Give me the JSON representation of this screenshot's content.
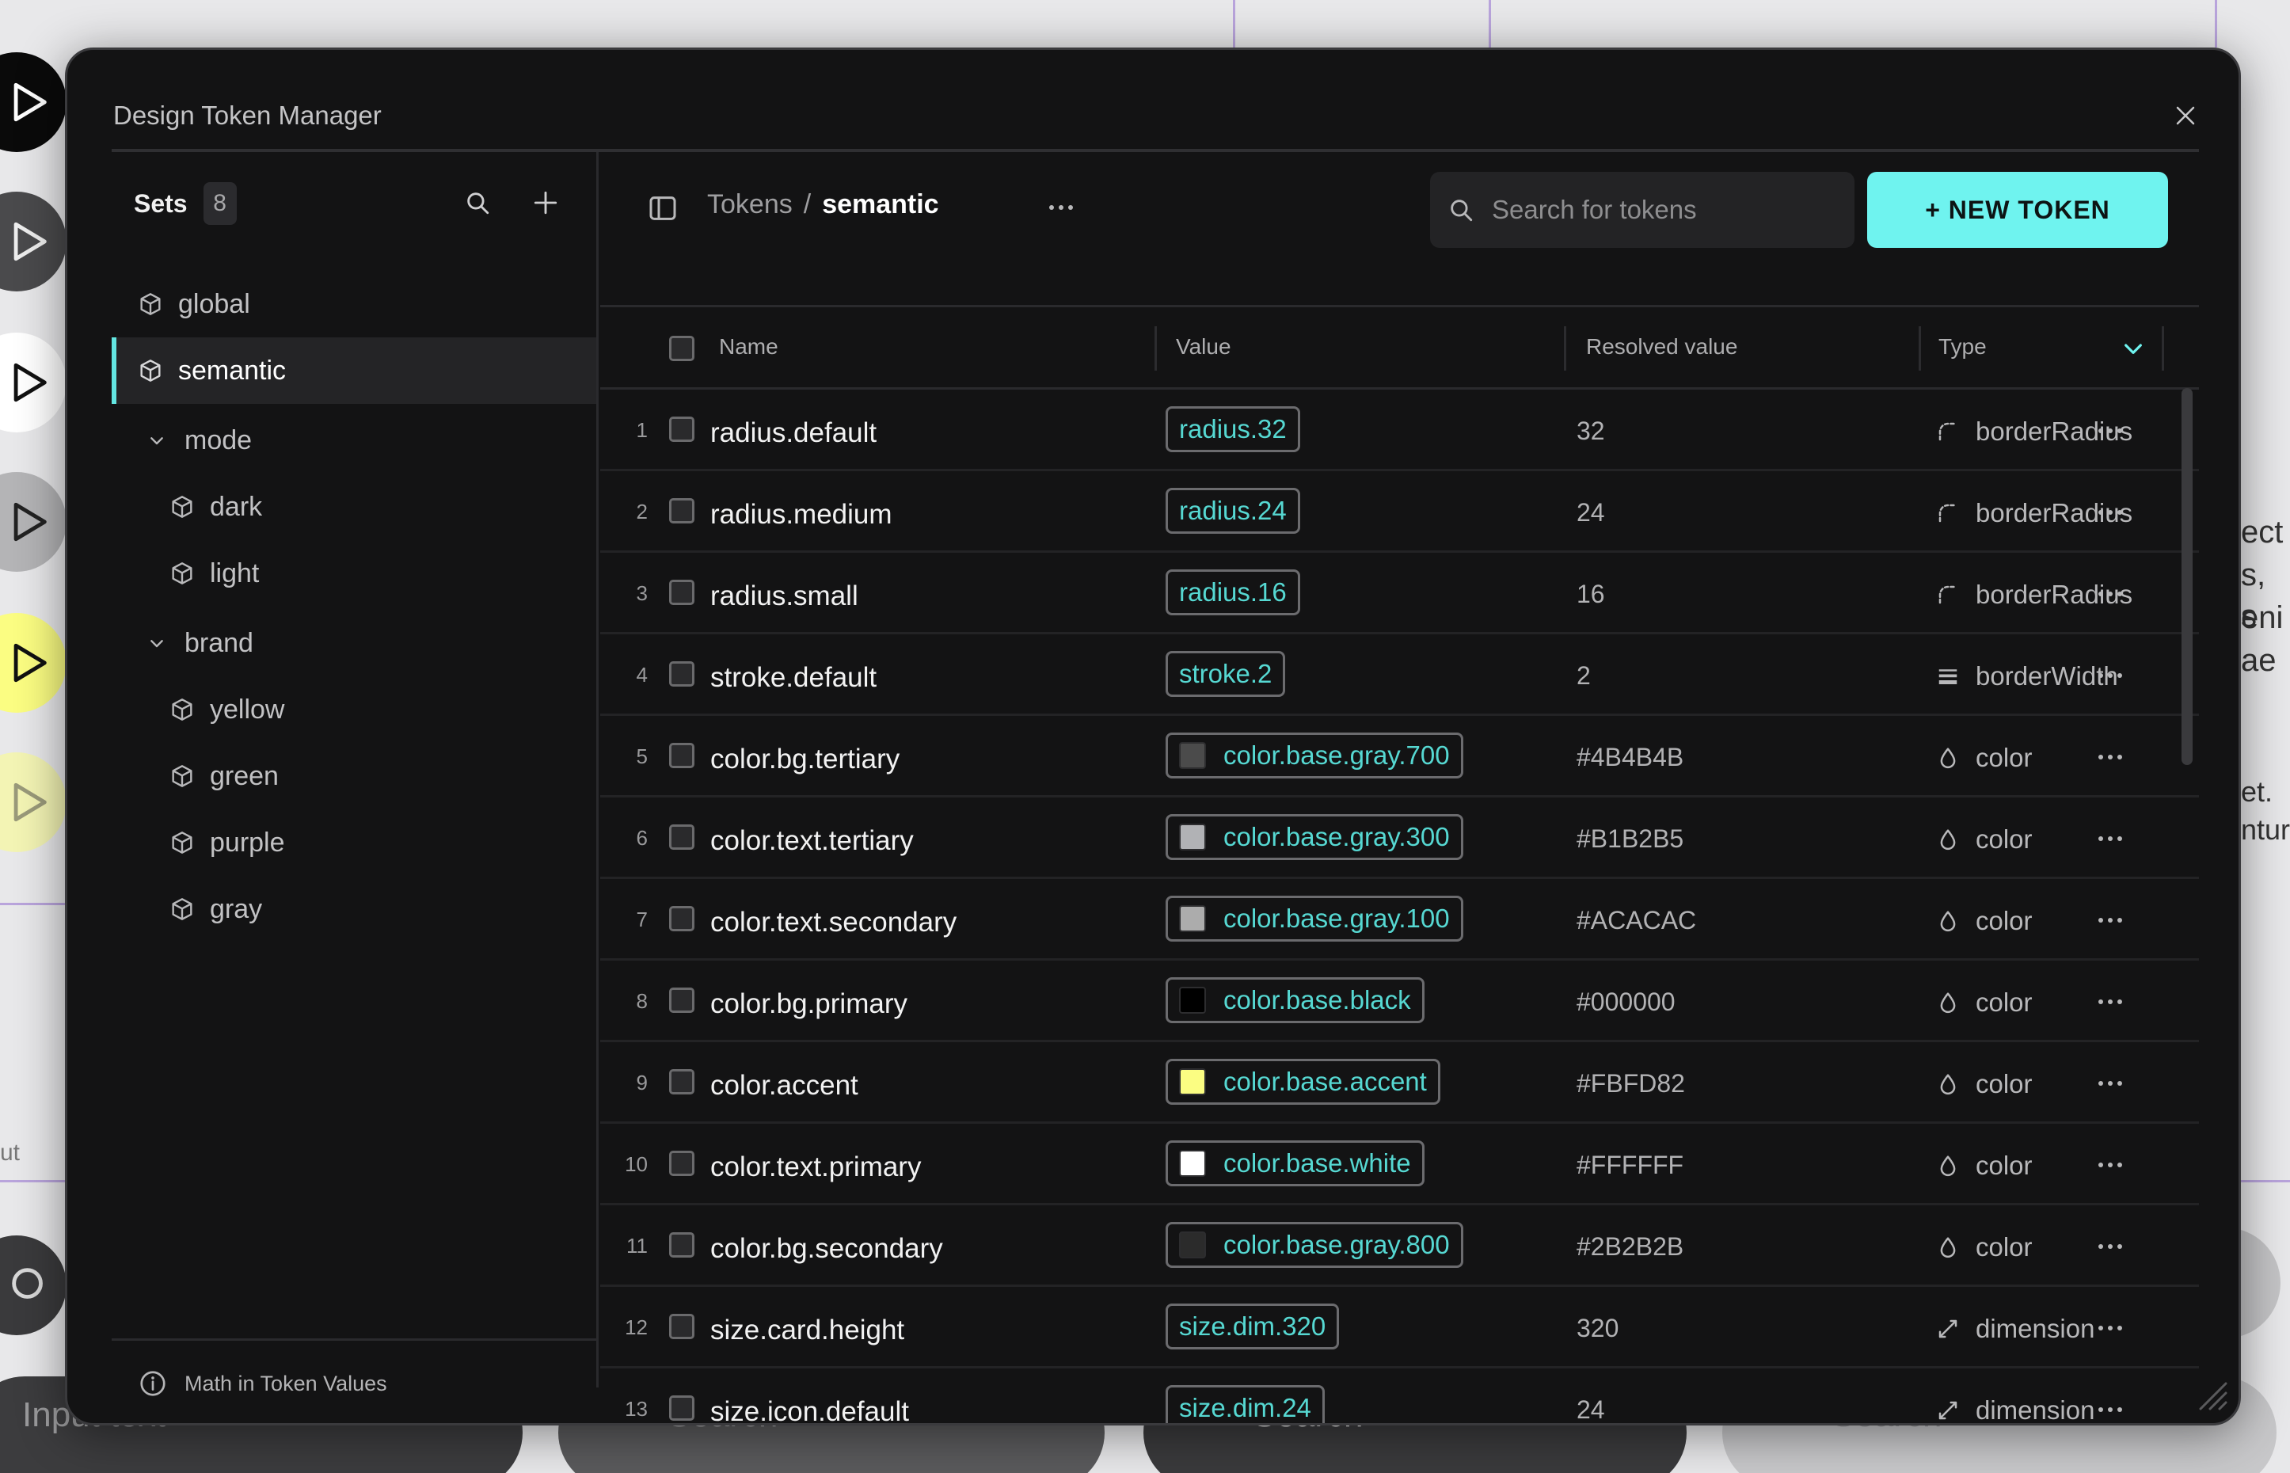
{
  "background": {
    "fragments": [
      "ect",
      "s, s",
      "eni",
      "ae",
      "et.",
      "ntur",
      "ut"
    ],
    "inputs": [
      "Input text",
      "Search",
      "Search",
      "Search"
    ]
  },
  "dialog": {
    "title": "Design Token Manager"
  },
  "sidebar": {
    "sets_label": "Sets",
    "sets_count": "8",
    "items": [
      {
        "label": "global",
        "icon": "cube-icon",
        "active": false
      },
      {
        "label": "semantic",
        "icon": "cube-icon",
        "active": true
      },
      {
        "label": "mode",
        "icon": "chevron-down-icon",
        "active": false
      },
      {
        "label": "dark",
        "icon": "cube-icon",
        "active": false
      },
      {
        "label": "light",
        "icon": "cube-icon",
        "active": false
      },
      {
        "label": "brand",
        "icon": "chevron-down-icon",
        "active": false
      },
      {
        "label": "yellow",
        "icon": "cube-icon",
        "active": false
      },
      {
        "label": "green",
        "icon": "cube-icon",
        "active": false
      },
      {
        "label": "purple",
        "icon": "cube-icon",
        "active": false
      },
      {
        "label": "gray",
        "icon": "cube-icon",
        "active": false
      }
    ],
    "footer_link": "Math in Token Values"
  },
  "toolbar": {
    "breadcrumb_root": "Tokens",
    "breadcrumb_sep": "/",
    "breadcrumb_current": "semantic",
    "search_placeholder": "Search for tokens",
    "new_token_label": "+ NEW TOKEN"
  },
  "table": {
    "headers": {
      "name": "Name",
      "value": "Value",
      "resolved": "Resolved value",
      "type": "Type"
    },
    "rows": [
      {
        "num": "1",
        "name": "radius.default",
        "value": "radius.32",
        "resolved": "32",
        "type": "borderRadius",
        "type_icon": "border-radius-icon",
        "swatch": null
      },
      {
        "num": "2",
        "name": "radius.medium",
        "value": "radius.24",
        "resolved": "24",
        "type": "borderRadius",
        "type_icon": "border-radius-icon",
        "swatch": null
      },
      {
        "num": "3",
        "name": "radius.small",
        "value": "radius.16",
        "resolved": "16",
        "type": "borderRadius",
        "type_icon": "border-radius-icon",
        "swatch": null
      },
      {
        "num": "4",
        "name": "stroke.default",
        "value": "stroke.2",
        "resolved": "2",
        "type": "borderWidth",
        "type_icon": "border-width-icon",
        "swatch": null
      },
      {
        "num": "5",
        "name": "color.bg.tertiary",
        "value": "color.base.gray.700",
        "resolved": "#4B4B4B",
        "type": "color",
        "type_icon": "droplet-icon",
        "swatch": "#4B4B4B"
      },
      {
        "num": "6",
        "name": "color.text.tertiary",
        "value": "color.base.gray.300",
        "resolved": "#B1B2B5",
        "type": "color",
        "type_icon": "droplet-icon",
        "swatch": "#B1B2B5"
      },
      {
        "num": "7",
        "name": "color.text.secondary",
        "value": "color.base.gray.100",
        "resolved": "#ACACAC",
        "type": "color",
        "type_icon": "droplet-icon",
        "swatch": "#ACACAC"
      },
      {
        "num": "8",
        "name": "color.bg.primary",
        "value": "color.base.black",
        "resolved": "#000000",
        "type": "color",
        "type_icon": "droplet-icon",
        "swatch": "#000000"
      },
      {
        "num": "9",
        "name": "color.accent",
        "value": "color.base.accent",
        "resolved": "#FBFD82",
        "type": "color",
        "type_icon": "droplet-icon",
        "swatch": "#FBFD82"
      },
      {
        "num": "10",
        "name": "color.text.primary",
        "value": "color.base.white",
        "resolved": "#FFFFFF",
        "type": "color",
        "type_icon": "droplet-icon",
        "swatch": "#FFFFFF"
      },
      {
        "num": "11",
        "name": "color.bg.secondary",
        "value": "color.base.gray.800",
        "resolved": "#2B2B2B",
        "type": "color",
        "type_icon": "droplet-icon",
        "swatch": "#2B2B2B"
      },
      {
        "num": "12",
        "name": "size.card.height",
        "value": "size.dim.320",
        "resolved": "320",
        "type": "dimension",
        "type_icon": "dimension-icon",
        "swatch": null
      },
      {
        "num": "13",
        "name": "size.icon.default",
        "value": "size.dim.24",
        "resolved": "24",
        "type": "dimension",
        "type_icon": "dimension-icon",
        "swatch": null
      }
    ]
  },
  "colors": {
    "accent": "#6FF3EF",
    "reference_text": "#56D8D2",
    "dialog_bg": "#131314"
  }
}
